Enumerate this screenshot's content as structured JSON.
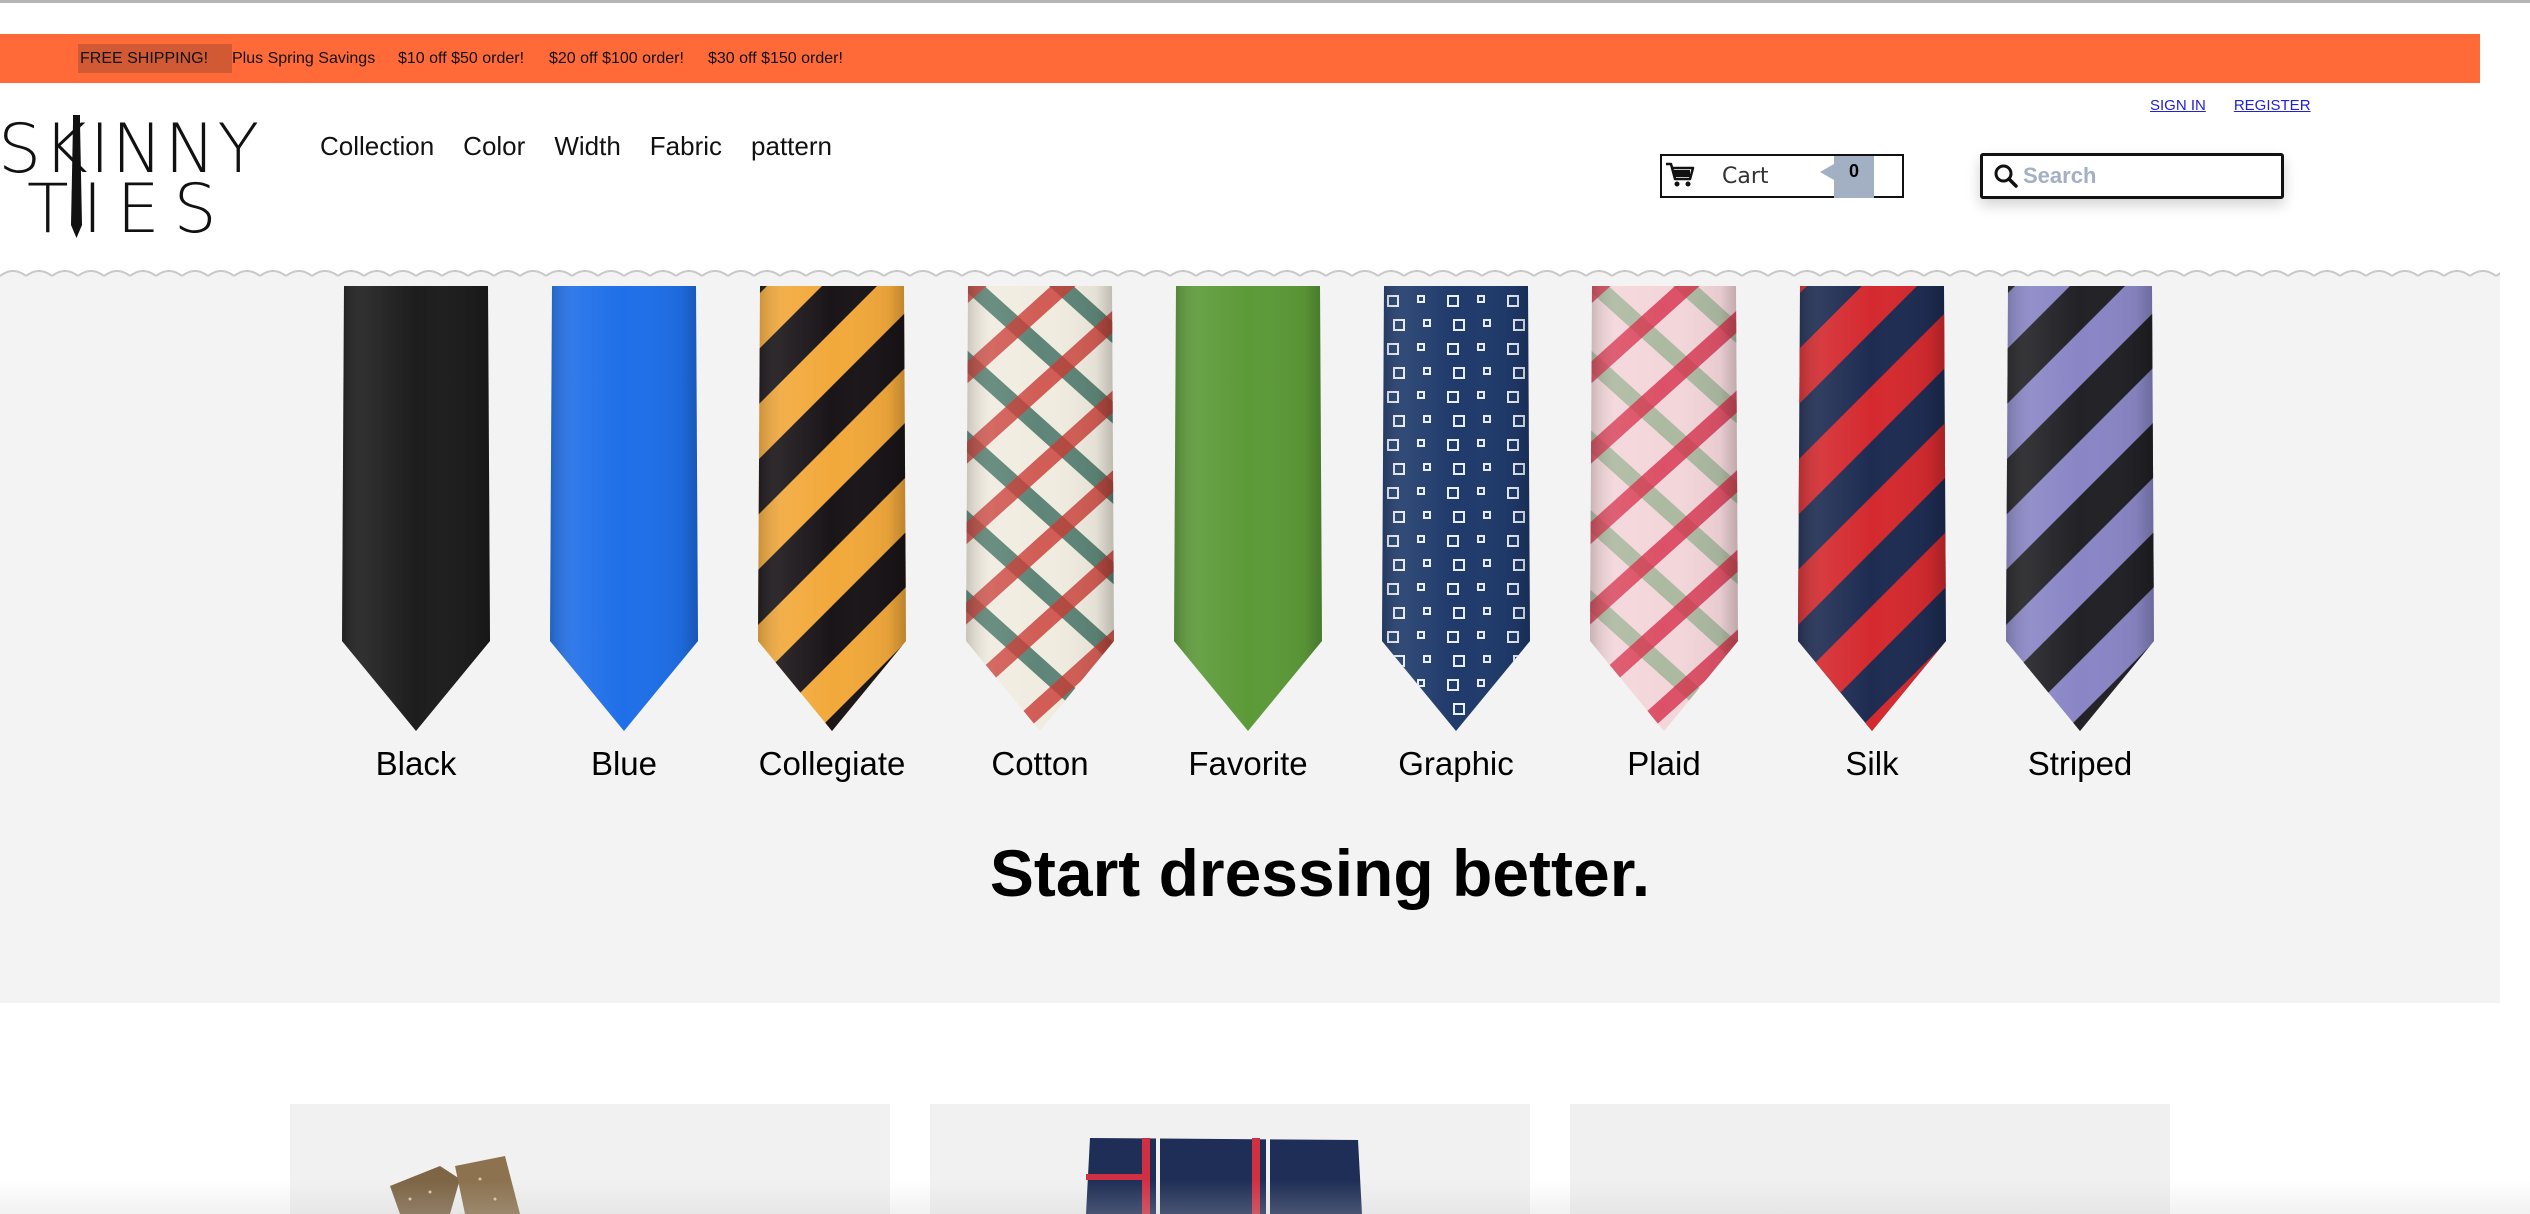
{
  "promo": {
    "highlight": "FREE SHIPPING!",
    "items": [
      "Plus Spring Savings",
      "$10 off $50 order!",
      "$20 off $100 order!",
      "$30 off $150 order!"
    ]
  },
  "logo": {
    "line1": "SKINNY",
    "line2": "TIES"
  },
  "nav": [
    "Collection",
    "Color",
    "Width",
    "Fabric",
    "pattern"
  ],
  "account": {
    "sign_in": "SIGN IN",
    "register": "REGISTER"
  },
  "cart": {
    "label": "Cart",
    "count": "0",
    "icon": "cart-icon"
  },
  "search": {
    "placeholder": "Search",
    "value": "",
    "icon": "search-icon"
  },
  "ties": [
    {
      "label": "Black",
      "pattern": "solid",
      "colors": [
        "#1d1d1d"
      ]
    },
    {
      "label": "Blue",
      "pattern": "solid",
      "colors": [
        "#1f6fe8"
      ]
    },
    {
      "label": "Collegiate",
      "pattern": "stripe",
      "colors": [
        "#f2a93b",
        "#1a1518"
      ]
    },
    {
      "label": "Cotton",
      "pattern": "plaid",
      "colors": [
        "#f1ece0",
        "#c93a32",
        "#1f5a4c"
      ]
    },
    {
      "label": "Favorite",
      "pattern": "solid",
      "colors": [
        "#5c9a38"
      ]
    },
    {
      "label": "Graphic",
      "pattern": "dots",
      "colors": [
        "#1f3a6b",
        "#e8eef8"
      ]
    },
    {
      "label": "Plaid",
      "pattern": "plaid",
      "colors": [
        "#f3d6da",
        "#d6304a",
        "#8fae8a"
      ]
    },
    {
      "label": "Silk",
      "pattern": "stripe",
      "colors": [
        "#1e2c52",
        "#d42a2f"
      ]
    },
    {
      "label": "Striped",
      "pattern": "stripe",
      "colors": [
        "#8a86c6",
        "#222226"
      ]
    }
  ],
  "headline": "Start dressing better.",
  "colors": {
    "promo_bar": "#ff6a38",
    "link": "#2020dd",
    "cart_badge": "#a3afc3",
    "gallery_bg": "#f3f3f3"
  }
}
